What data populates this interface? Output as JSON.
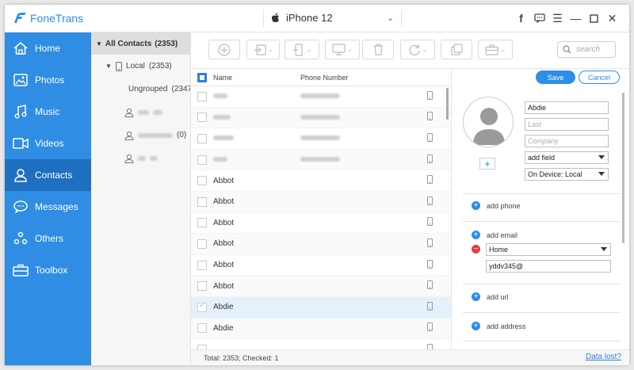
{
  "app": {
    "title": "FoneTrans"
  },
  "device": {
    "name": "iPhone 12"
  },
  "sidebar": {
    "items": [
      {
        "label": "Home",
        "icon": "home-icon"
      },
      {
        "label": "Photos",
        "icon": "photo-icon"
      },
      {
        "label": "Music",
        "icon": "music-icon"
      },
      {
        "label": "Videos",
        "icon": "video-icon"
      },
      {
        "label": "Contacts",
        "icon": "contacts-icon",
        "active": true
      },
      {
        "label": "Messages",
        "icon": "messages-icon"
      },
      {
        "label": "Others",
        "icon": "others-icon"
      },
      {
        "label": "Toolbox",
        "icon": "toolbox-icon"
      }
    ]
  },
  "tree": {
    "all_contacts": "All Contacts",
    "all_count": "(2353)",
    "local": "Local",
    "local_count": "(2353)",
    "ungrouped": "Ungrouped",
    "ungrouped_count": "(2347",
    "group_count": "(0)"
  },
  "toolbar": {
    "search_placeholder": "search"
  },
  "list": {
    "headers": {
      "name": "Name",
      "phone": "Phone Number"
    },
    "rows": [
      {
        "name": "",
        "blurred": true
      },
      {
        "name": "",
        "blurred": true
      },
      {
        "name": "",
        "blurred": true
      },
      {
        "name": "",
        "blurred": true
      },
      {
        "name": "Abbot"
      },
      {
        "name": "Abbot"
      },
      {
        "name": "Abbot"
      },
      {
        "name": "Abbot"
      },
      {
        "name": "Abbot"
      },
      {
        "name": "Abbot"
      },
      {
        "name": "Abdie",
        "selected": true
      },
      {
        "name": "Abdie"
      },
      {
        "name": ""
      }
    ]
  },
  "status": {
    "text": "Total: 2353; Checked: 1",
    "data_lost": "Data lost?"
  },
  "detail": {
    "save": "Save",
    "cancel": "Cancel",
    "first_name": "Abdie",
    "last_placeholder": "Last",
    "company_placeholder": "Company",
    "add_field": "add field",
    "on_device": "On Device: Local",
    "add_phone": "add phone",
    "add_email": "add email",
    "email_type": "Home",
    "email_value": "yddv345@",
    "add_url": "add url",
    "add_address": "add address"
  },
  "colors": {
    "accent": "#2d8ee6",
    "sidebar": "#2f8de4",
    "sidebar_active": "#1e6fbf",
    "remove": "#e53e3e"
  }
}
